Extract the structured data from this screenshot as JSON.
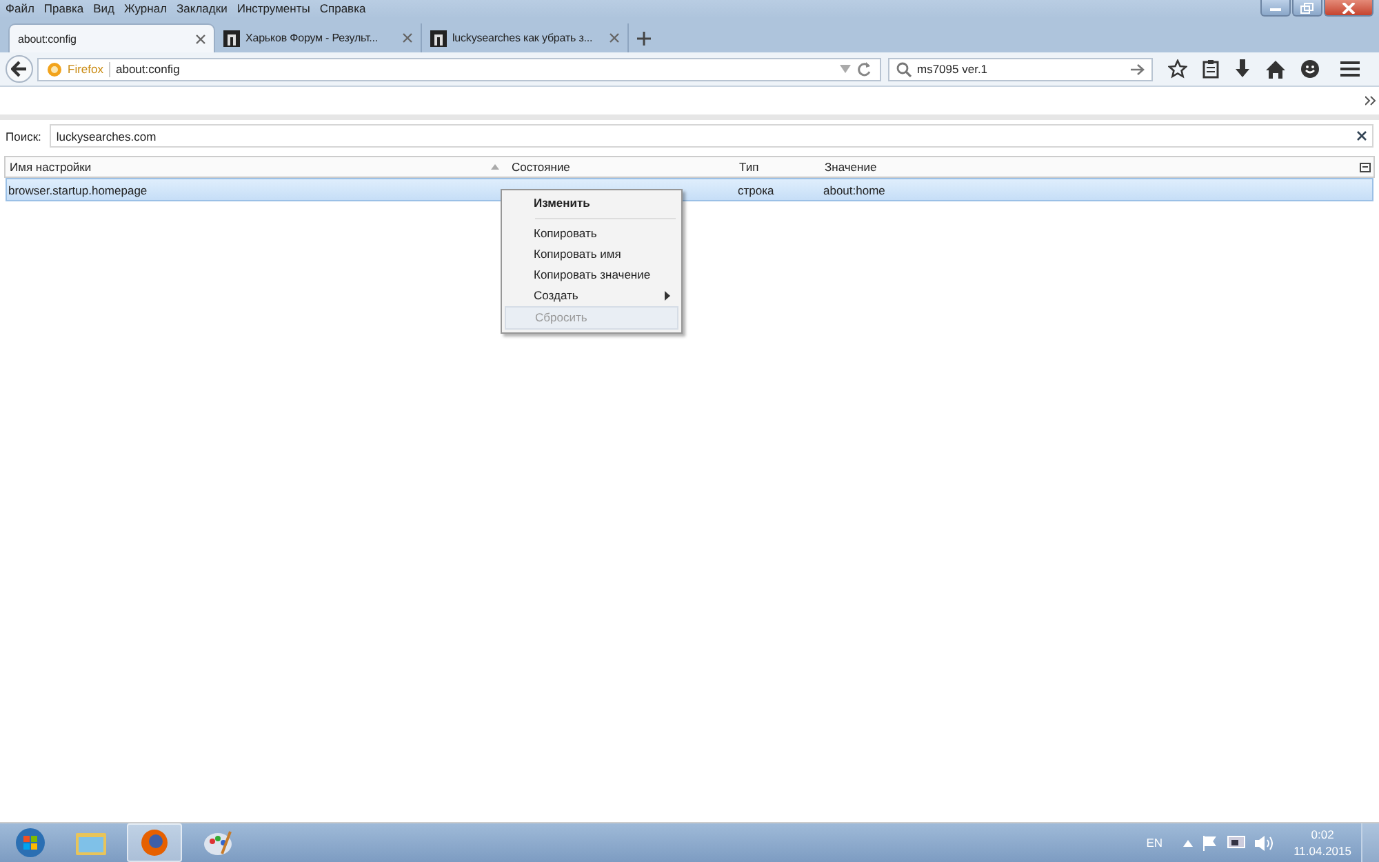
{
  "menu_bar": [
    "Файл",
    "Правка",
    "Вид",
    "Журнал",
    "Закладки",
    "Инструменты",
    "Справка"
  ],
  "tabs": [
    {
      "title": "about:config",
      "selected": true,
      "favicon": false
    },
    {
      "title": "Харьков Форум - Результ...",
      "selected": false,
      "favicon": true
    },
    {
      "title": "luckysearches как убрать з...",
      "selected": false,
      "favicon": true
    }
  ],
  "nav": {
    "identity": "Firefox",
    "url": "about:config",
    "search": "ms7095 ver.1"
  },
  "filter": {
    "label": "Поиск:",
    "value": "luckysearches.com"
  },
  "table": {
    "columns": [
      "Имя настройки",
      "Состояние",
      "Тип",
      "Значение"
    ],
    "rows": [
      {
        "name": "browser.startup.homepage",
        "type": "строка",
        "value": "about:home",
        "selected": true
      }
    ]
  },
  "context_menu": [
    {
      "kind": "item",
      "label": "Изменить",
      "default": true,
      "disabled": false,
      "submenu": false
    },
    {
      "kind": "separator"
    },
    {
      "kind": "item",
      "label": "Копировать",
      "default": false,
      "disabled": false,
      "submenu": false
    },
    {
      "kind": "item",
      "label": "Копировать имя",
      "default": false,
      "disabled": false,
      "submenu": false
    },
    {
      "kind": "item",
      "label": "Копировать значение",
      "default": false,
      "disabled": false,
      "submenu": false
    },
    {
      "kind": "item",
      "label": "Создать",
      "default": false,
      "disabled": false,
      "submenu": true
    },
    {
      "kind": "item",
      "label": "Сбросить",
      "default": false,
      "disabled": true,
      "submenu": false
    }
  ],
  "taskbar": {
    "apps": [
      {
        "kind": "folder",
        "active": false
      },
      {
        "kind": "browser",
        "active": true
      },
      {
        "kind": "paint",
        "active": false
      }
    ],
    "language": "EN",
    "time": "0:02",
    "date": "11.04.2015"
  }
}
